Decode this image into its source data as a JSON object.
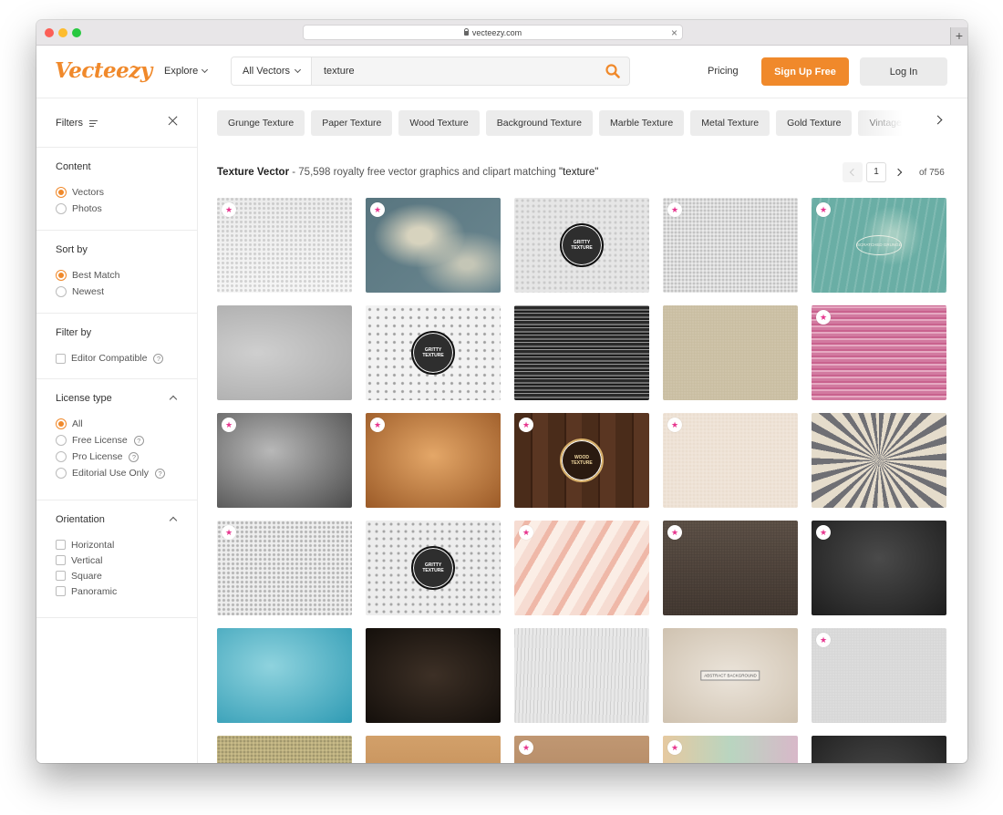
{
  "browser": {
    "url": "vecteezy.com",
    "new_tab": "+"
  },
  "header": {
    "logo": "Vecteezy",
    "explore": "Explore",
    "search_category": "All Vectors",
    "search_value": "texture",
    "pricing": "Pricing",
    "signup": "Sign Up Free",
    "login": "Log In"
  },
  "sidebar": {
    "title": "Filters",
    "content": {
      "title": "Content",
      "options": [
        "Vectors",
        "Photos"
      ],
      "selected": "Vectors"
    },
    "sort": {
      "title": "Sort by",
      "options": [
        "Best Match",
        "Newest"
      ],
      "selected": "Best Match"
    },
    "filter": {
      "title": "Filter by",
      "options": [
        "Editor Compatible"
      ]
    },
    "license": {
      "title": "License type",
      "options": [
        "All",
        "Free License",
        "Pro License",
        "Editorial Use Only"
      ],
      "selected": "All",
      "help_icon": "?"
    },
    "orientation": {
      "title": "Orientation",
      "options": [
        "Horizontal",
        "Vertical",
        "Square",
        "Panoramic"
      ]
    }
  },
  "chips": [
    "Grunge Texture",
    "Paper Texture",
    "Wood Texture",
    "Background Texture",
    "Marble Texture",
    "Metal Texture",
    "Gold Texture",
    "Vintage Texture"
  ],
  "results": {
    "title": "Texture Vector",
    "description": "- 75,598 royalty free vector graphics and clipart matching",
    "query": "\"texture\"",
    "page": "1",
    "of": "of 756"
  },
  "thumbnails": [
    {
      "bg": "#ececec",
      "badge": true
    },
    {
      "bg": "#5e7c86",
      "badge": true
    },
    {
      "bg": "#e6e6e6",
      "badge": false,
      "seal": "GRITTY TEXTURE"
    },
    {
      "bg": "#ededed",
      "badge": true
    },
    {
      "bg": "#6aaea5",
      "badge": true,
      "label": "SCRATCHED GRUNGE"
    },
    {
      "bg": "#bfbfbf",
      "badge": false
    },
    {
      "bg": "#f2f2f2",
      "badge": false,
      "seal": "GRITTY TEXTURE"
    },
    {
      "bg": "#3a3a3a",
      "badge": false
    },
    {
      "bg": "#d7ccb3",
      "badge": false
    },
    {
      "bg": "#d48aa8",
      "badge": true
    },
    {
      "bg": "#8b8b8b",
      "badge": true
    },
    {
      "bg": "#c98a4a",
      "badge": true
    },
    {
      "bg": "#4a2c1a",
      "badge": true,
      "seal": "WOOD TEXTURE"
    },
    {
      "bg": "#f1e6da",
      "badge": true
    },
    {
      "bg": "#a6a6a0",
      "badge": false
    },
    {
      "bg": "#eeeeee",
      "badge": true
    },
    {
      "bg": "#ededed",
      "badge": false,
      "seal": "GRITTY TEXTURE"
    },
    {
      "bg": "#f2cdc4",
      "badge": true
    },
    {
      "bg": "#5b4e44",
      "badge": true
    },
    {
      "bg": "#2d2d2d",
      "badge": true
    },
    {
      "bg": "#58b5c8",
      "badge": false
    },
    {
      "bg": "#251d17",
      "badge": false
    },
    {
      "bg": "#e8e8e8",
      "badge": false
    },
    {
      "bg": "#ddd3c6",
      "badge": false,
      "plate": "ABSTRACT BACKGROUND"
    },
    {
      "bg": "#e4e4e4",
      "badge": true
    },
    {
      "bg": "#cbbd8a",
      "badge": false
    },
    {
      "bg": "#c99860",
      "badge": false
    },
    {
      "bg": "#b98e6a",
      "badge": true
    },
    {
      "bg": "#d2c9ae",
      "badge": true
    },
    {
      "bg": "#3a3a3a",
      "badge": false
    }
  ]
}
